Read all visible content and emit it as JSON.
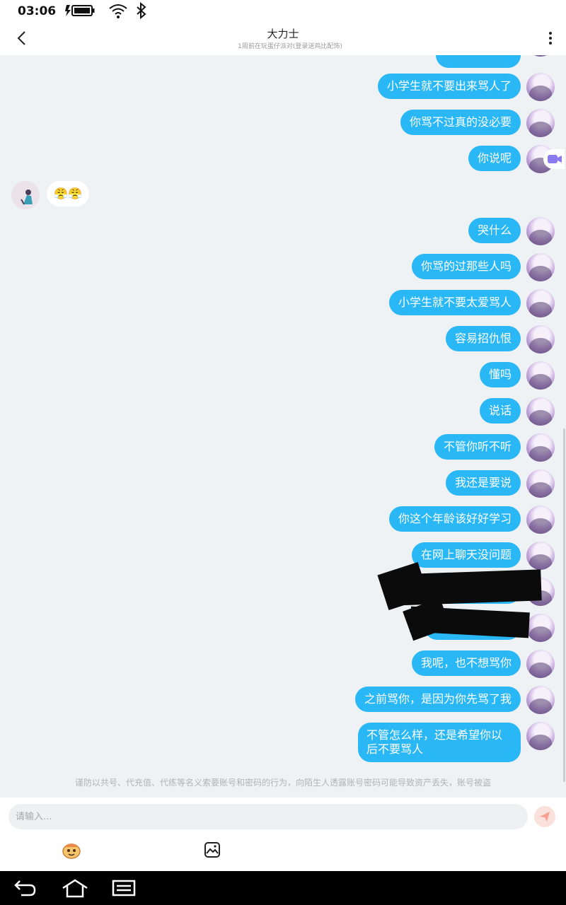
{
  "status_bar": {
    "time": "03:06"
  },
  "header": {
    "title": "大力士",
    "subtitle": "1周前在玩蛋仔派对(登录送鸡比配饰)"
  },
  "messages": [
    {
      "from": "me",
      "text": "小学生就不要出来骂人了"
    },
    {
      "from": "me",
      "text": "你骂不过真的没必要"
    },
    {
      "from": "me",
      "text": "你说呢"
    },
    {
      "from": "other",
      "text": "😤😤"
    },
    {
      "from": "me",
      "text": "哭什么"
    },
    {
      "from": "me",
      "text": "你骂的过那些人吗"
    },
    {
      "from": "me",
      "text": "小学生就不要太爱骂人"
    },
    {
      "from": "me",
      "text": "容易招仇恨"
    },
    {
      "from": "me",
      "text": "懂吗"
    },
    {
      "from": "me",
      "text": "说话"
    },
    {
      "from": "me",
      "text": "不管你听不听"
    },
    {
      "from": "me",
      "text": "我还是要说"
    },
    {
      "from": "me",
      "text": "你这个年龄该好好学习"
    },
    {
      "from": "me",
      "text": "在网上聊天没问题"
    },
    {
      "from": "me",
      "text": "",
      "redacted": true
    },
    {
      "from": "me",
      "text": "",
      "redacted": true
    },
    {
      "from": "me",
      "text": "我呢，也不想骂你"
    },
    {
      "from": "me",
      "text": "之前骂你，是因为你先骂了我"
    },
    {
      "from": "me",
      "text": "不管怎么样，还是希望你以后不要骂人"
    }
  ],
  "notice": "谨防以共号、代充值、代练等名义索要账号和密码的行为，向陌生人透露账号密码可能导致资产丢失，账号被盗",
  "input": {
    "placeholder": "请输入..."
  },
  "colors": {
    "bubble_out": "#29b7f5",
    "background": "#eef2f5"
  }
}
